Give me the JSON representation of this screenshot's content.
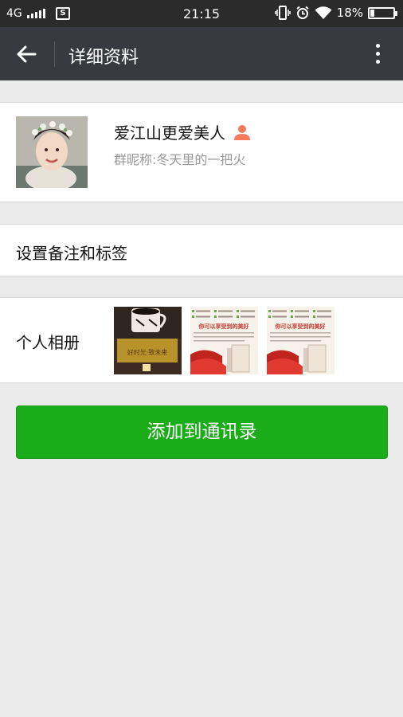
{
  "status_bar": {
    "network": "4G",
    "time": "21:15",
    "battery_percent": "18%",
    "battery_level": 0.18,
    "icons": [
      "signal-icon",
      "sim-icon",
      "vibrate-icon",
      "alarm-icon",
      "wifi-icon",
      "battery-icon"
    ]
  },
  "header": {
    "title": "详细资料",
    "back_icon": "arrow-left-icon",
    "more_icon": "more-vertical-icon",
    "bg_color": "#393a3f"
  },
  "profile": {
    "name": "爱江山更爱美人",
    "nickname_label": "群昵称: ",
    "nickname": "冬天里的一把火",
    "gender_icon": "person-icon",
    "gender_color": "#f37b5a"
  },
  "remark": {
    "label": "设置备注和标签"
  },
  "album": {
    "label": "个人相册",
    "thumbnails": [
      {
        "text": "好时光·致未来"
      },
      {
        "text": "你可以享受到的美好"
      },
      {
        "text": "你可以享受到的美好"
      }
    ]
  },
  "actions": {
    "add_button": "添加到通讯录",
    "button_color": "#1aad19"
  }
}
